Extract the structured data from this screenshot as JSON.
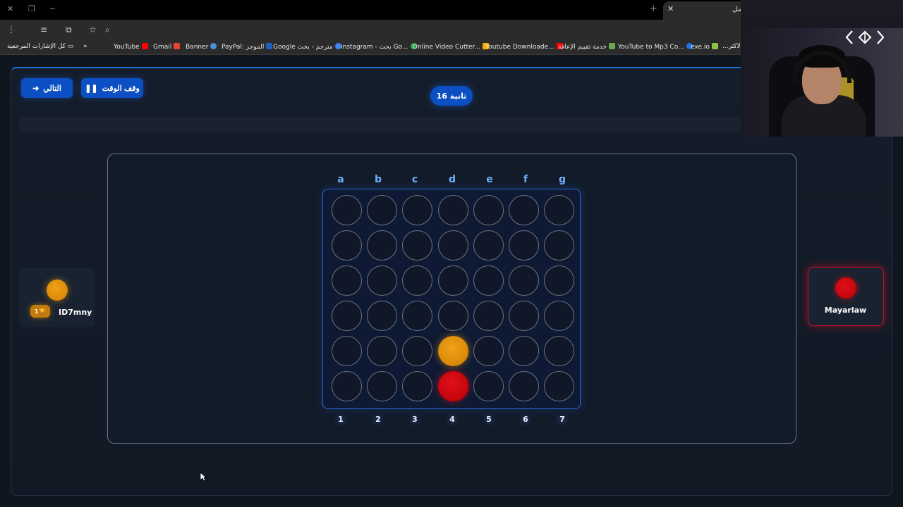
{
  "browser": {
    "active_tab_title": "ضل",
    "bookmarks": [
      {
        "label": "كل الإشارات المرجعية",
        "icon": "folder-icon"
      },
      {
        "label": "YouTube",
        "icon": "youtube-icon",
        "color": "#ff0000"
      },
      {
        "label": "Gmail",
        "icon": "gmail-icon",
        "color": "#ea4335"
      },
      {
        "label": "Banner",
        "icon": "banner-icon",
        "color": "#4a90d9"
      },
      {
        "label": "PayPal: الموجز",
        "icon": "paypal-icon",
        "color": "#1f5fbf"
      },
      {
        "label": "Google مترجم - بحث",
        "icon": "google-icon",
        "color": "#4285f4"
      },
      {
        "label": "instagram - بحث Go...",
        "icon": "google-icon",
        "color": "#34a853"
      },
      {
        "label": "Online Video Cutter...",
        "icon": "video-cutter-icon",
        "color": "#f4b400"
      },
      {
        "label": "Youtube Downloade...",
        "icon": "downloader-icon",
        "color": "#ff0000"
      },
      {
        "label": "خدمة تقييم الإعاقة",
        "icon": "gov-icon",
        "color": "#6aa84f"
      },
      {
        "label": "YouTube to Mp3 Co...",
        "icon": "mp3-icon",
        "color": "#1a73e8"
      },
      {
        "label": "exe.io",
        "icon": "exeio-icon",
        "color": "#8bc34a"
      },
      {
        "label": "...الاكثر",
        "icon": "",
        "color": ""
      }
    ]
  },
  "game": {
    "next_label": "التالي",
    "pause_label": "وقف الوقت",
    "timer_label": "16 ثانية",
    "columns_letters": [
      "a",
      "b",
      "c",
      "d",
      "e",
      "f",
      "g"
    ],
    "columns_numbers": [
      "1",
      "2",
      "3",
      "4",
      "5",
      "6",
      "7"
    ],
    "rows": 6,
    "cols": 7,
    "board": [
      [
        "",
        "",
        "",
        "",
        "",
        "",
        ""
      ],
      [
        "",
        "",
        "",
        "",
        "",
        "",
        ""
      ],
      [
        "",
        "",
        "",
        "",
        "",
        "",
        ""
      ],
      [
        "",
        "",
        "",
        "",
        "",
        "",
        ""
      ],
      [
        "",
        "",
        "",
        "yellow",
        "",
        "",
        ""
      ],
      [
        "",
        "",
        "",
        "red",
        "",
        "",
        ""
      ]
    ],
    "colors": {
      "accent": "#0c4fc2",
      "yellow": "#e8940f",
      "red": "#d0060f"
    }
  },
  "players": {
    "left": {
      "name": "ID7mny",
      "trophies": "1",
      "color": "yellow"
    },
    "right": {
      "name": "Mayarlaw",
      "color": "red",
      "active": true
    }
  }
}
